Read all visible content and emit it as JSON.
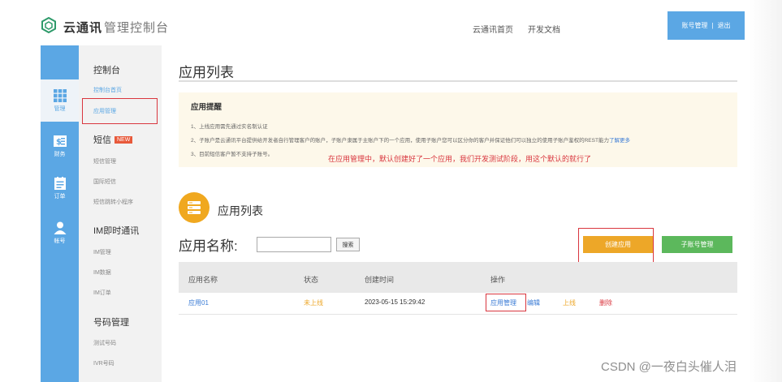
{
  "brand": {
    "name": "云通讯",
    "subtitle": "管理控制台"
  },
  "topnav": {
    "home": "云通讯首页",
    "docs": "开发文档",
    "account": "账号管理",
    "separator": "|",
    "logout": "退出"
  },
  "rail": [
    {
      "label": "管理",
      "icon": "grid-icon"
    },
    {
      "label": "财务",
      "icon": "finance-icon"
    },
    {
      "label": "订单",
      "icon": "order-icon"
    },
    {
      "label": "帐号",
      "icon": "user-icon"
    }
  ],
  "subnav": {
    "console": {
      "title": "控制台",
      "items": [
        "控制台首页",
        "应用管理"
      ]
    },
    "sms": {
      "title": "短信",
      "badge": "NEW",
      "items": [
        "短信管理",
        "国际短信",
        "短信跳转小程序"
      ]
    },
    "im": {
      "title": "IM即时通讯",
      "items": [
        "IM管理",
        "IM数据",
        "IM订单"
      ]
    },
    "number": {
      "title": "号码管理",
      "items": [
        "测试号码",
        "IVR号码"
      ]
    }
  },
  "main": {
    "title": "应用列表",
    "notice": {
      "title": "应用提醒",
      "lines": [
        "1、上线应用需先通过实名制认证",
        "2、子账户是云通讯平台提供给开发者自行管理客户的账户，子账户隶属于主账户下的一个应用，使用子账户您可以区分你的客户并保证他们可以独立的使用子账户鉴权的REST能力",
        "3、目前短信客户暂不支持子账号。"
      ],
      "link": "了解更多"
    },
    "annotation": "在应用管理中，默认创建好了一个应用，我们开发测试阶段，用这个默认的就行了",
    "list_heading": "应用列表",
    "search": {
      "label": "应用名称:",
      "value": "",
      "button": "搜索"
    },
    "create_button": "创建应用",
    "sub_account_button": "子账号管理",
    "table": {
      "headers": [
        "应用名称",
        "状态",
        "创建时间",
        "操作"
      ],
      "row": {
        "name": "应用01",
        "status": "未上线",
        "created": "2023-05-15 15:29:42",
        "ops": [
          "应用管理",
          "编辑",
          "上线",
          "删除"
        ]
      }
    }
  },
  "watermark": "CSDN @一夜白头催人泪",
  "colors": {
    "accent": "#5ba7e4",
    "orange": "#eda728",
    "green": "#5cb85c",
    "red": "#d9363e",
    "notice_bg": "#fdf8ea"
  }
}
